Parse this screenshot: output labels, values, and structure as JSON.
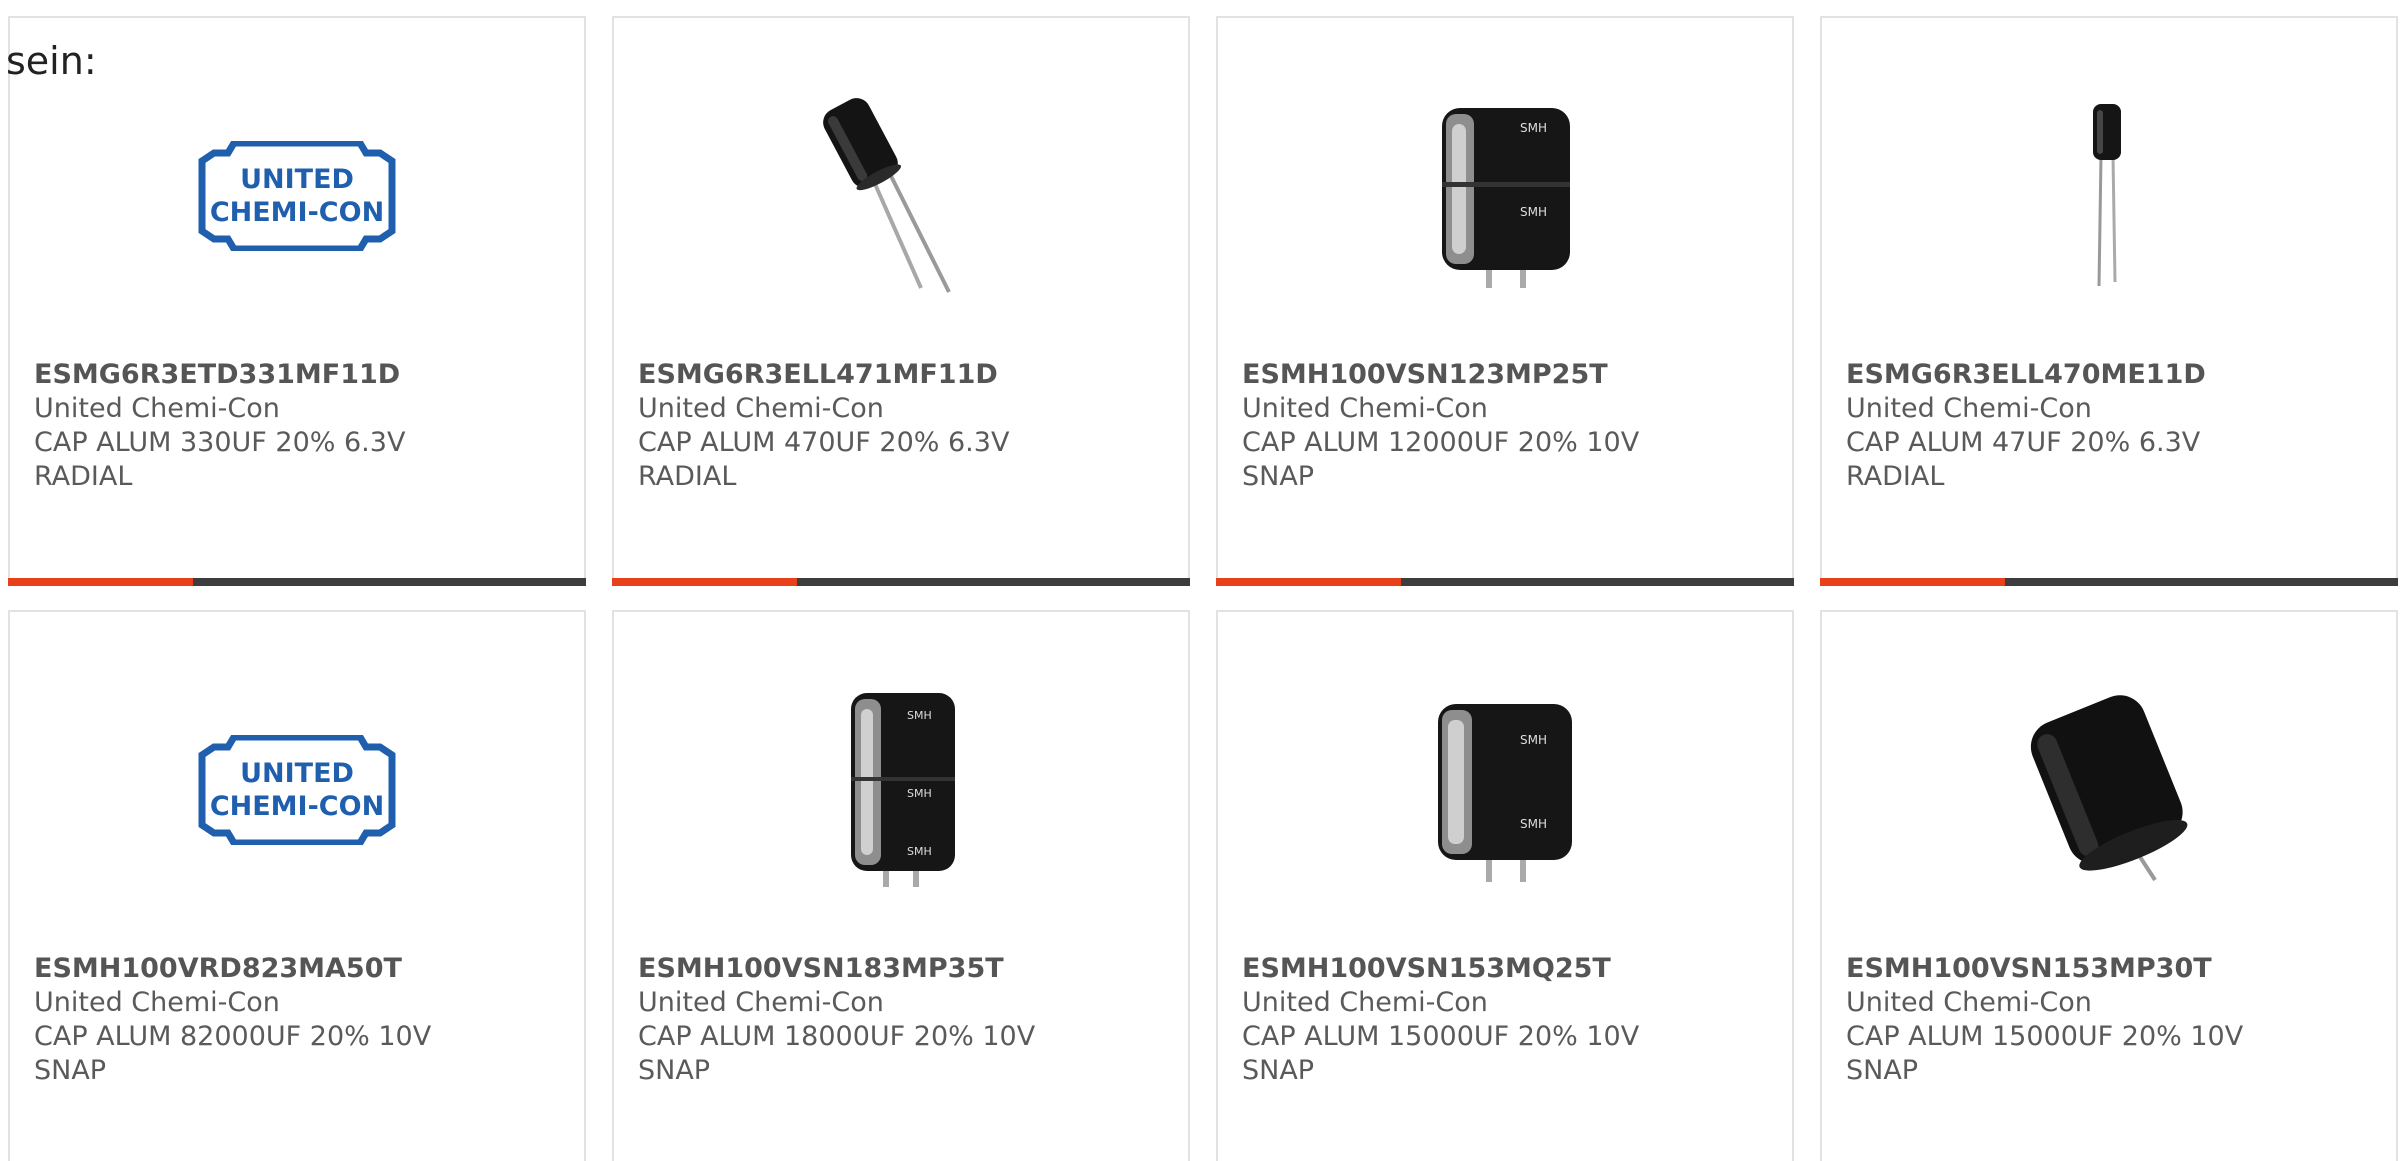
{
  "intro_text": "sein:",
  "colors": {
    "accent": "#e8401a",
    "bar": "#3d3d3d",
    "border": "#e2e2e2",
    "logo_blue": "#1f5fae"
  },
  "products": [
    {
      "part_number": "ESMG6R3ETD331MF11D",
      "manufacturer": "United Chemi-Con",
      "description": "CAP ALUM 330UF 20% 6.3V",
      "package": "RADIAL",
      "image": "united-chemi-con-logo",
      "logo_line1": "UNITED",
      "logo_line2": "CHEMI-CON"
    },
    {
      "part_number": "ESMG6R3ELL471MF11D",
      "manufacturer": "United Chemi-Con",
      "description": "CAP ALUM 470UF 20% 6.3V",
      "package": "RADIAL",
      "image": "radial-capacitor-tilted"
    },
    {
      "part_number": "ESMH100VSN123MP25T",
      "manufacturer": "United Chemi-Con",
      "description": "CAP ALUM 12000UF 20% 10V",
      "package": "SNAP",
      "image": "snap-in-capacitor",
      "can_text": "SMH"
    },
    {
      "part_number": "ESMG6R3ELL470ME11D",
      "manufacturer": "United Chemi-Con",
      "description": "CAP ALUM 47UF 20% 6.3V",
      "package": "RADIAL",
      "image": "small-radial-capacitor"
    },
    {
      "part_number": "ESMH100VRD823MA50T",
      "manufacturer": "United Chemi-Con",
      "description": "CAP ALUM 82000UF 20% 10V",
      "package": "SNAP",
      "image": "united-chemi-con-logo",
      "logo_line1": "UNITED",
      "logo_line2": "CHEMI-CON"
    },
    {
      "part_number": "ESMH100VSN183MP35T",
      "manufacturer": "United Chemi-Con",
      "description": "CAP ALUM 18000UF 20% 10V",
      "package": "SNAP",
      "image": "tall-snap-in-capacitor",
      "can_text": "SMH"
    },
    {
      "part_number": "ESMH100VSN153MQ25T",
      "manufacturer": "United Chemi-Con",
      "description": "CAP ALUM 15000UF 20% 10V",
      "package": "SNAP",
      "image": "snap-in-capacitor",
      "can_text": "SMH"
    },
    {
      "part_number": "ESMH100VSN153MP30T",
      "manufacturer": "United Chemi-Con",
      "description": "CAP ALUM 15000UF 20% 10V",
      "package": "SNAP",
      "image": "snap-in-capacitor-angled"
    }
  ]
}
